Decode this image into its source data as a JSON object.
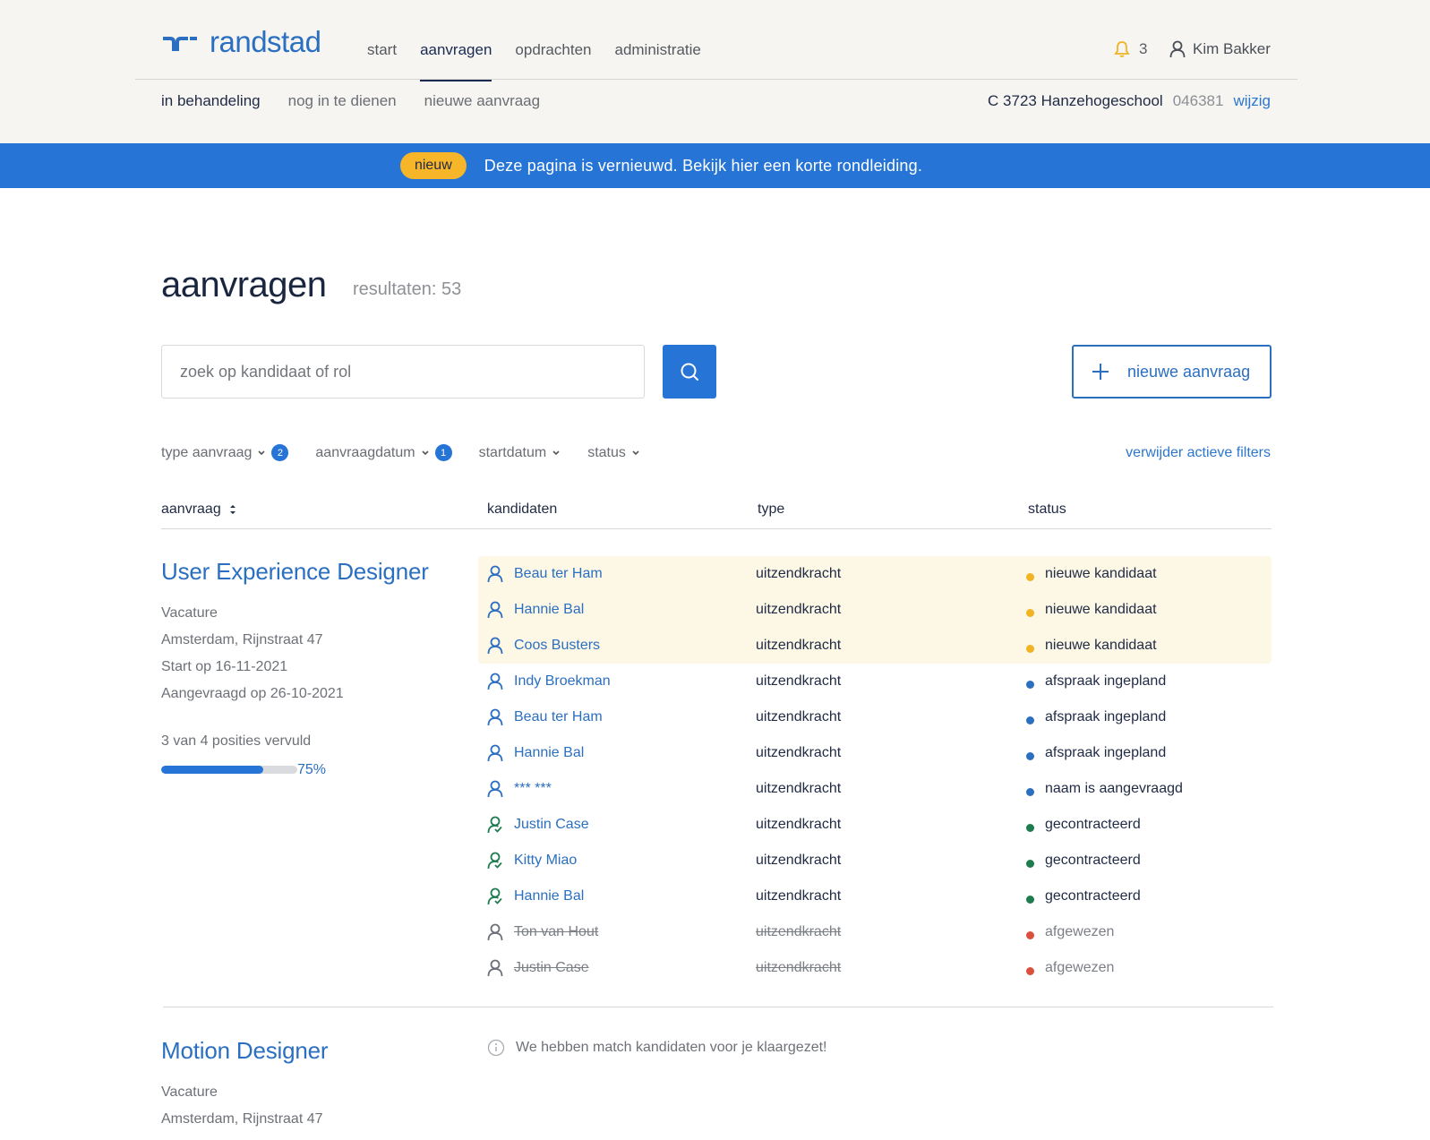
{
  "header": {
    "logo_text": "randstad",
    "nav": [
      "start",
      "aanvragen",
      "opdrachten",
      "administratie"
    ],
    "notification_count": "3",
    "user_name": "Kim Bakker",
    "subnav": [
      "in behandeling",
      "nog in te dienen",
      "nieuwe aanvraag"
    ],
    "client_name": "C 3723 Hanzehogeschool",
    "client_code": "046381",
    "client_change": "wijzig"
  },
  "banner": {
    "badge": "nieuw",
    "text": "Deze pagina is vernieuwd. Bekijk hier een korte rondleiding."
  },
  "page": {
    "title": "aanvragen",
    "results": "resultaten: 53",
    "search_placeholder": "zoek op kandidaat of rol",
    "new_request": "nieuwe aanvraag"
  },
  "filters": {
    "items": [
      {
        "label": "type aanvraag",
        "count": "2"
      },
      {
        "label": "aanvraagdatum",
        "count": "1"
      },
      {
        "label": "startdatum",
        "count": ""
      },
      {
        "label": "status",
        "count": ""
      }
    ],
    "clear": "verwijder actieve filters"
  },
  "table": {
    "headers": [
      "aanvraag",
      "kandidaten",
      "type",
      "status"
    ]
  },
  "requests": [
    {
      "title": "User Experience Designer",
      "kind": "Vacature",
      "location": "Amsterdam, Rijnstraat 47",
      "start": "Start op 16-11-2021",
      "requested": "Aangevraagd op 26-10-2021",
      "filled": "3 van 4 posities vervuld",
      "progress_pct": "75%",
      "progress_fraction": 0.75,
      "candidates": [
        {
          "name": "Beau ter Ham",
          "type": "uitzendkracht",
          "status": "nieuwe kandidaat",
          "state": "new"
        },
        {
          "name": "Hannie Bal",
          "type": "uitzendkracht",
          "status": "nieuwe kandidaat",
          "state": "new"
        },
        {
          "name": "Coos Busters",
          "type": "uitzendkracht",
          "status": "nieuwe kandidaat",
          "state": "new"
        },
        {
          "name": "Indy Broekman",
          "type": "uitzendkracht",
          "status": "afspraak ingepland",
          "state": "planned"
        },
        {
          "name": "Beau ter Ham",
          "type": "uitzendkracht",
          "status": "afspraak ingepland",
          "state": "planned"
        },
        {
          "name": "Hannie Bal",
          "type": "uitzendkracht",
          "status": "afspraak ingepland",
          "state": "planned"
        },
        {
          "name": "*** ***",
          "type": "uitzendkracht",
          "status": "naam is aangevraagd",
          "state": "planned"
        },
        {
          "name": "Justin Case",
          "type": "uitzendkracht",
          "status": "gecontracteerd",
          "state": "contracted"
        },
        {
          "name": "Kitty Miao",
          "type": "uitzendkracht",
          "status": "gecontracteerd",
          "state": "contracted"
        },
        {
          "name": "Hannie Bal",
          "type": "uitzendkracht",
          "status": "gecontracteerd",
          "state": "contracted"
        },
        {
          "name": "Ton van Hout",
          "type": "uitzendkracht",
          "status": "afgewezen",
          "state": "rejected"
        },
        {
          "name": "Justin Case",
          "type": "uitzendkracht",
          "status": "afgewezen",
          "state": "rejected"
        }
      ]
    },
    {
      "title": "Motion Designer",
      "kind": "Vacature",
      "location": "Amsterdam, Rijnstraat 47",
      "info": "We hebben match kandidaten voor je klaargezet!"
    }
  ],
  "colors": {
    "brand": "#2b6fc0",
    "banner": "#2675d6",
    "badge": "#f7b52a",
    "status_new": "#f0b323",
    "status_planned": "#2b6fc0",
    "status_contracted": "#1e7d4f",
    "status_rejected": "#d9503f"
  }
}
